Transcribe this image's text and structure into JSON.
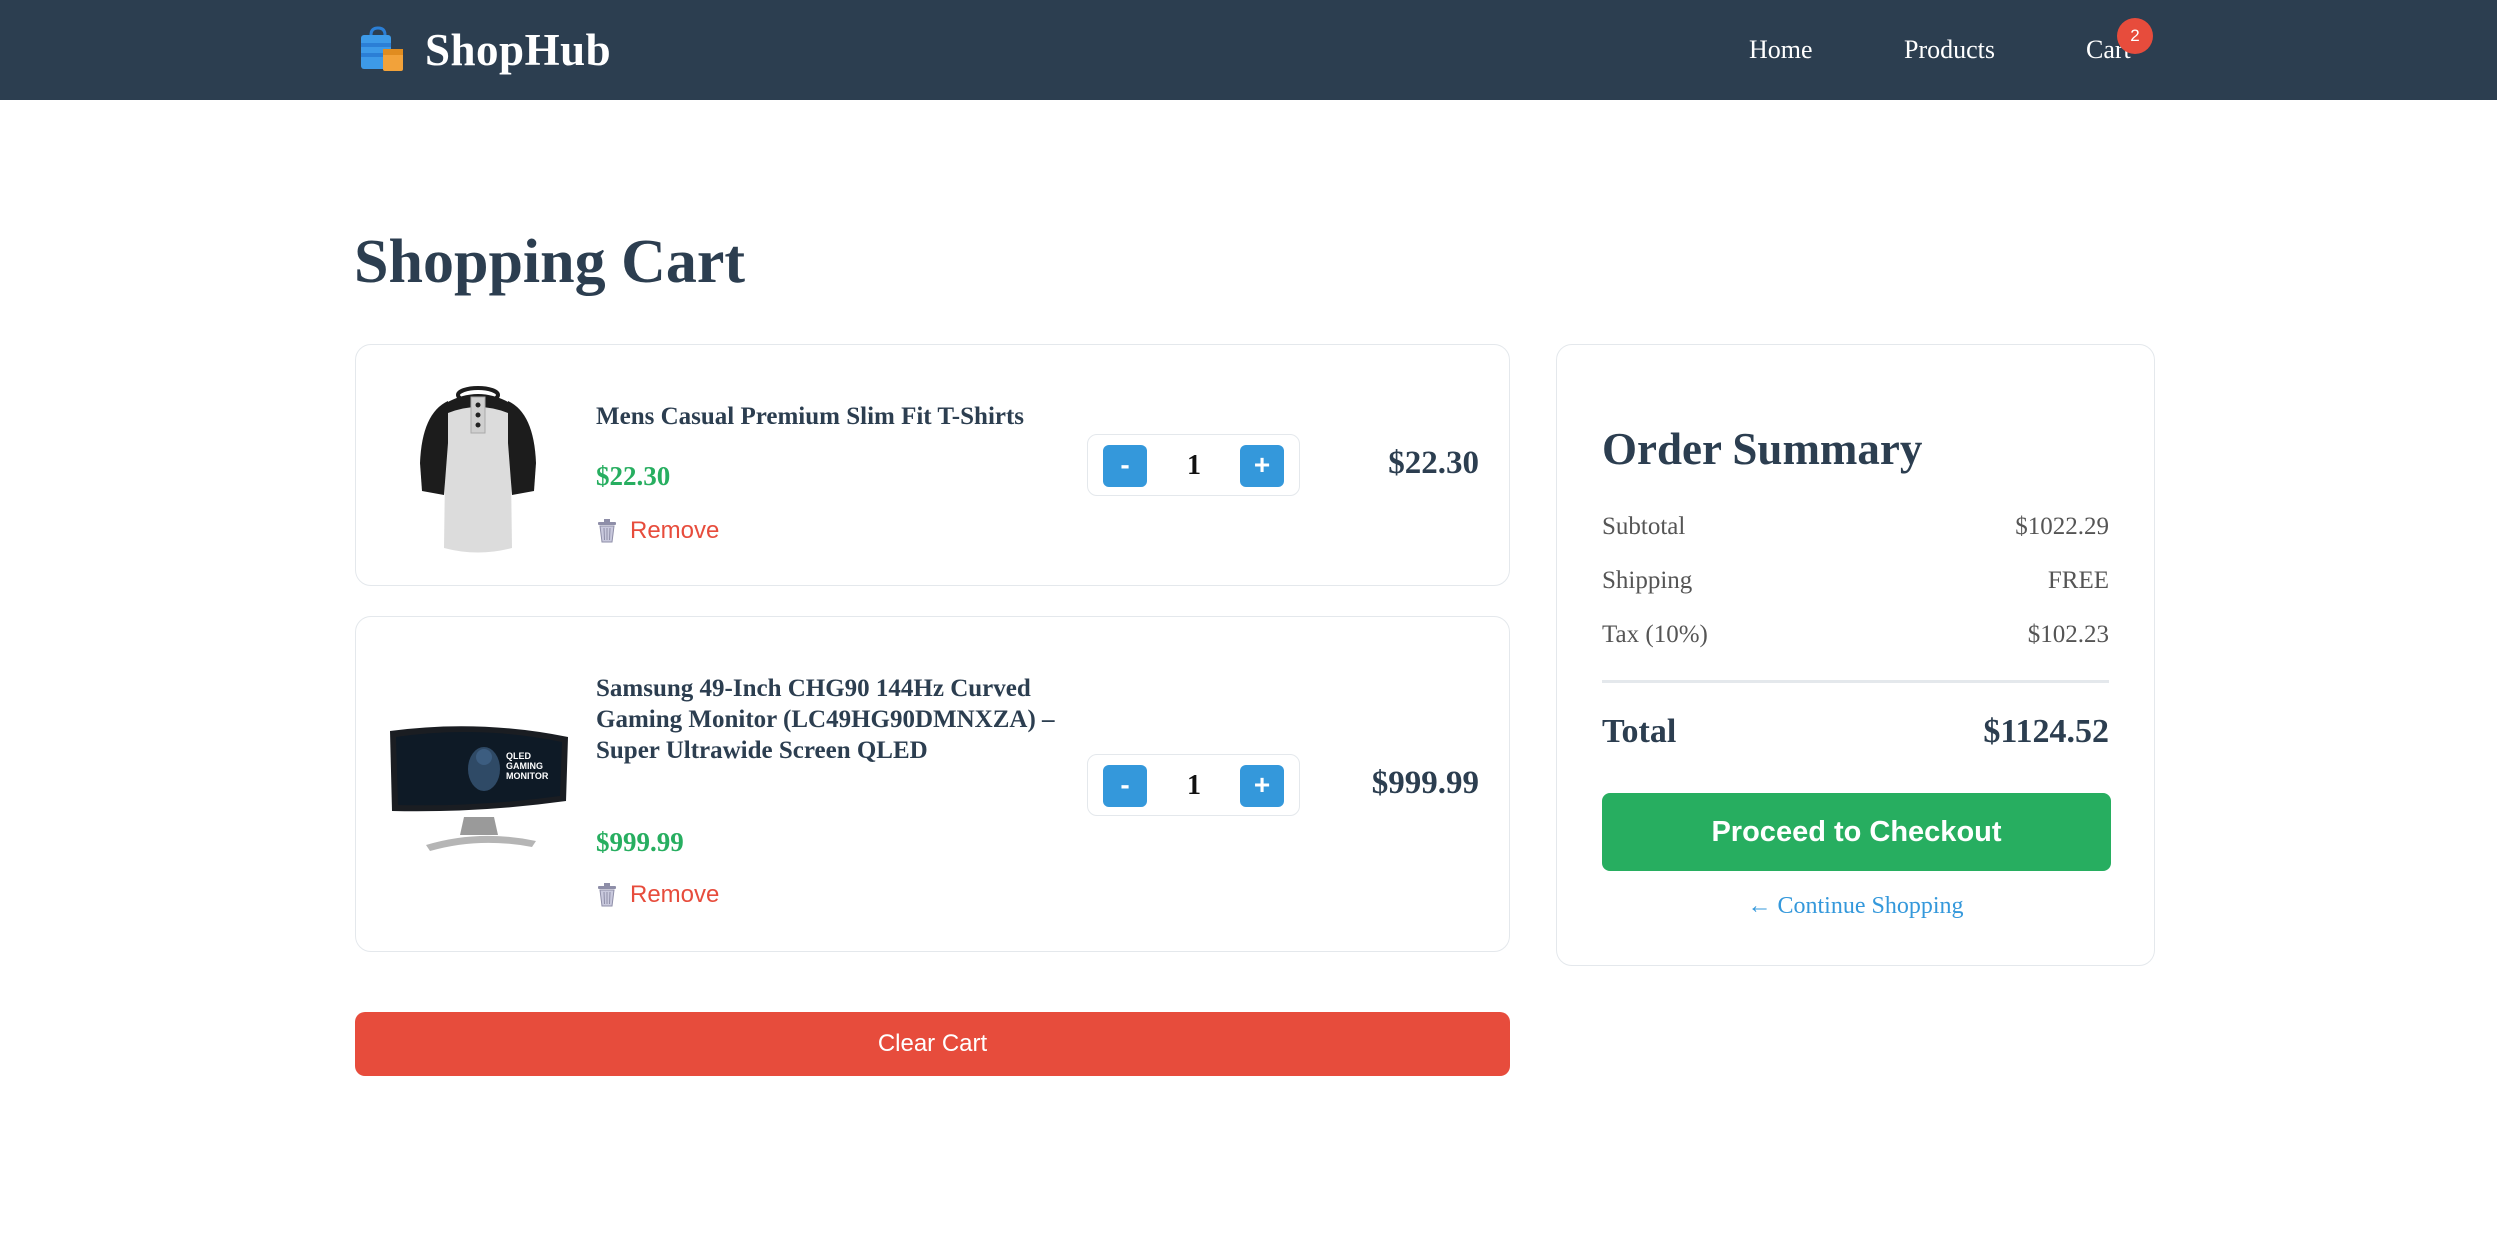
{
  "header": {
    "brand_name": "ShopHub",
    "nav": {
      "home": "Home",
      "products": "Products",
      "cart": "Cart"
    },
    "cart_count": "2"
  },
  "page_title": "Shopping Cart",
  "cart_items": [
    {
      "name": "Mens Casual Premium Slim Fit T-Shirts",
      "price": "$22.30",
      "quantity": "1",
      "line_total": "$22.30",
      "remove_label": "Remove",
      "minus_label": "-",
      "plus_label": "+"
    },
    {
      "name": "Samsung 49-Inch CHG90 144Hz Curved Gaming Monitor (LC49HG90DMNXZA) – Super Ultrawide Screen QLED",
      "price": "$999.99",
      "quantity": "1",
      "line_total": "$999.99",
      "remove_label": "Remove",
      "minus_label": "-",
      "plus_label": "+",
      "screen_text": "QLED GAMING MONITOR"
    }
  ],
  "clear_cart_label": "Clear Cart",
  "summary": {
    "title": "Order Summary",
    "subtotal_label": "Subtotal",
    "subtotal_value": "$1022.29",
    "shipping_label": "Shipping",
    "shipping_value": "FREE",
    "tax_label": "Tax (10%)",
    "tax_value": "$102.23",
    "total_label": "Total",
    "total_value": "$1124.52",
    "checkout_label": "Proceed to Checkout",
    "continue_label": "← Continue Shopping"
  },
  "colors": {
    "header_bg": "#2c3e50",
    "accent_blue": "#3498db",
    "price_green": "#27ae60",
    "danger_red": "#e74c3c"
  }
}
